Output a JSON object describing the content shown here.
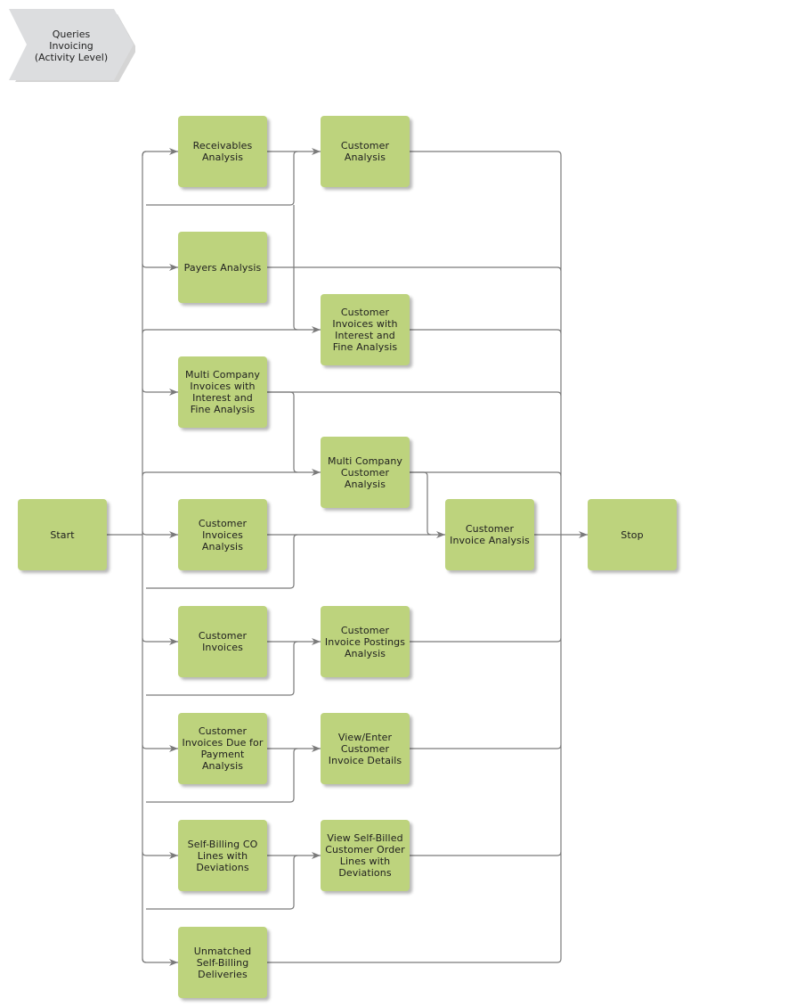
{
  "header": {
    "title": "Queries\nInvoicing\n(Activity Level)",
    "shape": "chevron",
    "fill": "#dcdddf"
  },
  "colors": {
    "node_fill": "#bdd37d",
    "connector": "#7a7a7a"
  },
  "nodes": {
    "start": "Start",
    "stop": "Stop",
    "receivables_analysis": "Receivables\nAnalysis",
    "payers_analysis": "Payers Analysis",
    "multi_company_invoices_interest_fine": "Multi Company\nInvoices with\nInterest and\nFine Analysis",
    "customer_invoices_analysis": "Customer\nInvoices\nAnalysis",
    "customer_invoices": "Customer\nInvoices",
    "customer_invoices_due_payment": "Customer\nInvoices Due for\nPayment\nAnalysis",
    "self_billing_co_lines_deviations": "Self-Billing CO\nLines with\nDeviations",
    "unmatched_self_billing_deliveries": "Unmatched\nSelf-Billing\nDeliveries",
    "customer_analysis": "Customer\nAnalysis",
    "customer_invoices_interest_fine": "Customer\nInvoices with\nInterest and\nFine Analysis",
    "multi_company_customer_analysis": "Multi Company\nCustomer\nAnalysis",
    "customer_invoice_analysis": "Customer\nInvoice Analysis",
    "customer_invoice_postings_analysis": "Customer\nInvoice Postings\nAnalysis",
    "view_enter_customer_invoice_details": "View/Enter\nCustomer\nInvoice Details",
    "view_self_billed_co_lines_deviations": "View Self-Billed\nCustomer Order\nLines with\nDeviations"
  },
  "edges": [
    [
      "start",
      "receivables_analysis"
    ],
    [
      "start",
      "payers_analysis"
    ],
    [
      "start",
      "multi_company_invoices_interest_fine"
    ],
    [
      "start",
      "customer_invoices_analysis"
    ],
    [
      "start",
      "customer_invoices"
    ],
    [
      "start",
      "customer_invoices_due_payment"
    ],
    [
      "start",
      "self_billing_co_lines_deviations"
    ],
    [
      "start",
      "unmatched_self_billing_deliveries"
    ],
    [
      "start",
      "customer_analysis"
    ],
    [
      "start",
      "customer_invoices_interest_fine"
    ],
    [
      "start",
      "multi_company_customer_analysis"
    ],
    [
      "start",
      "customer_invoice_analysis"
    ],
    [
      "start",
      "customer_invoice_postings_analysis"
    ],
    [
      "start",
      "view_enter_customer_invoice_details"
    ],
    [
      "start",
      "view_self_billed_co_lines_deviations"
    ],
    [
      "receivables_analysis",
      "customer_analysis"
    ],
    [
      "payers_analysis",
      "customer_analysis"
    ],
    [
      "payers_analysis",
      "customer_invoices_interest_fine"
    ],
    [
      "multi_company_invoices_interest_fine",
      "multi_company_customer_analysis"
    ],
    [
      "customer_invoices_analysis",
      "customer_invoice_analysis"
    ],
    [
      "customer_invoices",
      "customer_invoice_postings_analysis"
    ],
    [
      "customer_invoices_due_payment",
      "view_enter_customer_invoice_details"
    ],
    [
      "self_billing_co_lines_deviations",
      "view_self_billed_co_lines_deviations"
    ],
    [
      "multi_company_customer_analysis",
      "customer_invoice_analysis"
    ],
    [
      "customer_analysis",
      "stop"
    ],
    [
      "payers_analysis",
      "stop"
    ],
    [
      "customer_invoices_interest_fine",
      "stop"
    ],
    [
      "multi_company_invoices_interest_fine",
      "stop"
    ],
    [
      "multi_company_customer_analysis",
      "stop"
    ],
    [
      "customer_invoice_analysis",
      "stop"
    ],
    [
      "customer_invoice_postings_analysis",
      "stop"
    ],
    [
      "view_enter_customer_invoice_details",
      "stop"
    ],
    [
      "view_self_billed_co_lines_deviations",
      "stop"
    ],
    [
      "unmatched_self_billing_deliveries",
      "stop"
    ]
  ]
}
